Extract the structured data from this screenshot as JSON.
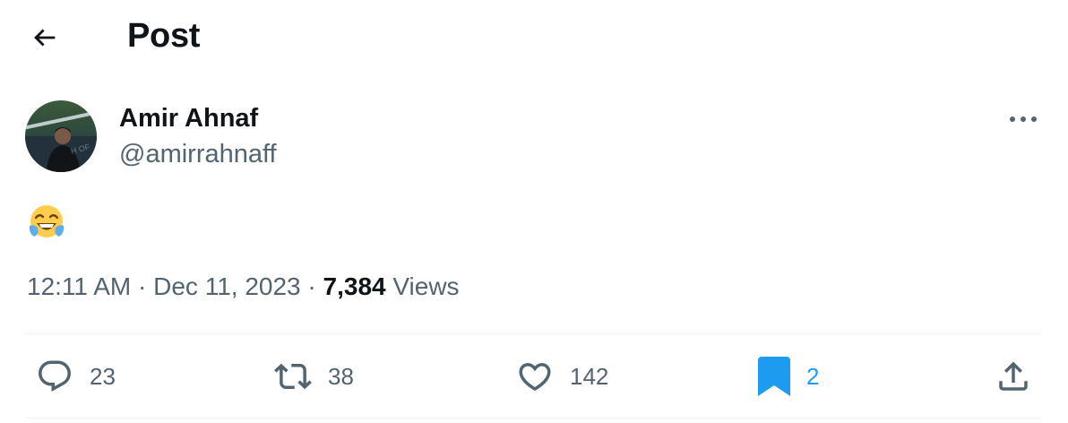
{
  "header": {
    "title": "Post",
    "back_icon": "arrow-left-icon"
  },
  "author": {
    "display_name": "Amir Ahnaf",
    "handle": "@amirrahnaff",
    "more_icon": "more-horizontal-icon"
  },
  "tweet": {
    "content_emoji": "face-with-tears-of-joy"
  },
  "meta": {
    "time": "12:11 AM",
    "separator": "·",
    "date": "Dec 11, 2023",
    "views_count": "7,384",
    "views_label": "Views"
  },
  "actions": {
    "reply": {
      "icon": "reply-icon",
      "count": "23"
    },
    "retweet": {
      "icon": "retweet-icon",
      "count": "38"
    },
    "like": {
      "icon": "heart-icon",
      "count": "142"
    },
    "bookmark": {
      "icon": "bookmark-icon",
      "count": "2",
      "active": true
    },
    "share": {
      "icon": "share-icon"
    }
  },
  "colors": {
    "text_primary": "#0f1419",
    "text_secondary": "#536471",
    "accent": "#1d9bf0",
    "divider": "#eff3f4"
  }
}
